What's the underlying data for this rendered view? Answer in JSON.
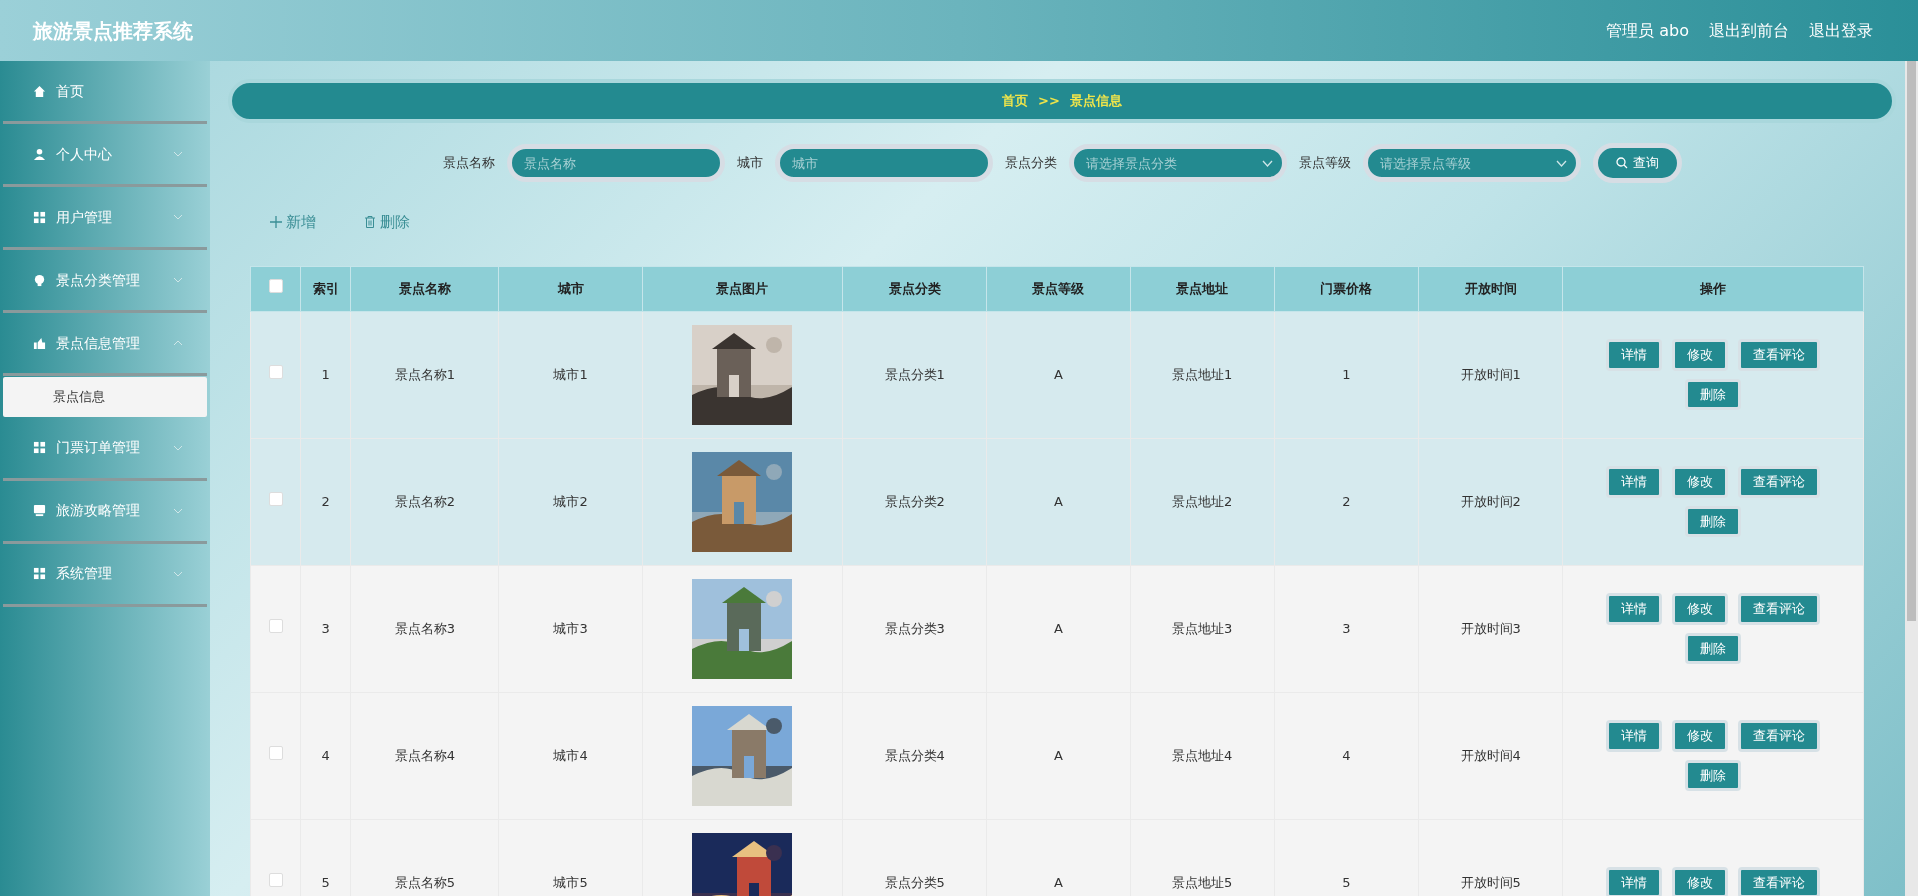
{
  "header": {
    "title": "旅游景点推荐系统",
    "links": [
      "管理员 abo",
      "退出到前台",
      "退出登录"
    ]
  },
  "sidebar": {
    "items": [
      {
        "label": "首页"
      },
      {
        "label": "个人中心",
        "expanded": false
      },
      {
        "label": "用户管理",
        "expanded": false
      },
      {
        "label": "景点分类管理",
        "expanded": false
      },
      {
        "label": "景点信息管理",
        "expanded": true,
        "children": [
          {
            "label": "景点信息",
            "selected": true
          }
        ]
      },
      {
        "label": "门票订单管理",
        "expanded": false
      },
      {
        "label": "旅游攻略管理",
        "expanded": false
      },
      {
        "label": "系统管理",
        "expanded": false
      }
    ]
  },
  "breadcrumb": [
    "首页",
    ">>",
    "景点信息"
  ],
  "search": {
    "fields": [
      {
        "label": "景点名称",
        "kind": "text",
        "placeholder": "景点名称"
      },
      {
        "label": "城市",
        "kind": "text",
        "placeholder": "城市"
      },
      {
        "label": "景点分类",
        "kind": "select",
        "placeholder": "请选择景点分类"
      },
      {
        "label": "景点等级",
        "kind": "select",
        "placeholder": "请选择景点等级"
      }
    ],
    "button": "查询"
  },
  "actions": [
    {
      "label": "新增",
      "kind": "add"
    },
    {
      "label": "删除",
      "kind": "delete"
    }
  ],
  "table": {
    "select_all": {
      "checked": false
    },
    "columns": [
      "索引",
      "景点名称",
      "城市",
      "景点图片",
      "景点分类",
      "景点等级",
      "景点地址",
      "门票价格",
      "开放时间",
      "操作"
    ],
    "rows": [
      {
        "checked": false,
        "highlighted": true,
        "cells": [
          "1",
          "景点名称1",
          "城市1",
          {
            "kind": "picture"
          },
          "景点分类1",
          "A",
          "景点地址1",
          "1",
          "开放时间1"
        ],
        "buttons": [
          "详情",
          "修改",
          "查看评论",
          "删除"
        ]
      },
      {
        "checked": false,
        "highlighted": true,
        "cells": [
          "2",
          "景点名称2",
          "城市2",
          {
            "kind": "picture"
          },
          "景点分类2",
          "A",
          "景点地址2",
          "2",
          "开放时间2"
        ],
        "buttons": [
          "详情",
          "修改",
          "查看评论",
          "删除"
        ]
      },
      {
        "checked": false,
        "highlighted": false,
        "cells": [
          "3",
          "景点名称3",
          "城市3",
          {
            "kind": "picture"
          },
          "景点分类3",
          "A",
          "景点地址3",
          "3",
          "开放时间3"
        ],
        "buttons": [
          "详情",
          "修改",
          "查看评论",
          "删除"
        ]
      },
      {
        "checked": false,
        "highlighted": false,
        "cells": [
          "4",
          "景点名称4",
          "城市4",
          {
            "kind": "picture"
          },
          "景点分类4",
          "A",
          "景点地址4",
          "4",
          "开放时间4"
        ],
        "buttons": [
          "详情",
          "修改",
          "查看评论",
          "删除"
        ]
      },
      {
        "checked": false,
        "highlighted": false,
        "cells": [
          "5",
          "景点名称5",
          "城市5",
          {
            "kind": "picture"
          },
          "景点分类5",
          "A",
          "景点地址5",
          "5",
          "开放时间5"
        ],
        "buttons": [
          "详情",
          "修改",
          "查看评论"
        ]
      }
    ]
  }
}
